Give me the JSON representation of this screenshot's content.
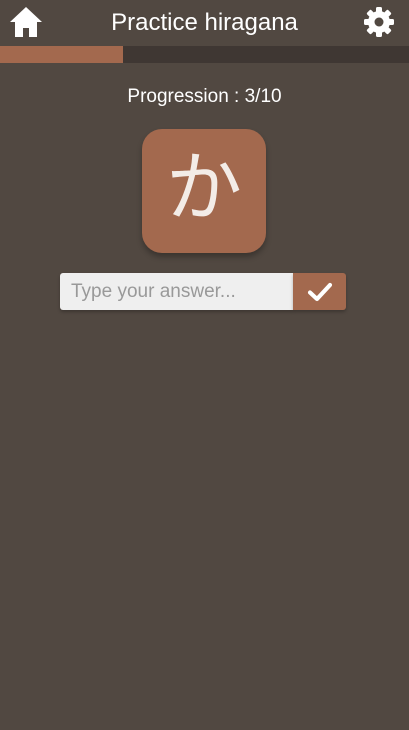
{
  "header": {
    "title": "Practice hiragana",
    "home_icon": "home-icon",
    "settings_icon": "gear-icon"
  },
  "progress": {
    "current": 3,
    "total": 10,
    "fraction": 0.3,
    "label": "Progression : 3/10"
  },
  "question": {
    "kana": "か"
  },
  "answer": {
    "value": "",
    "placeholder": "Type your answer...",
    "submit_icon": "checkmark-icon"
  },
  "colors": {
    "background": "#514841",
    "accent": "#a3694e",
    "progress_track": "#3f3733",
    "input_background": "#efefef"
  }
}
